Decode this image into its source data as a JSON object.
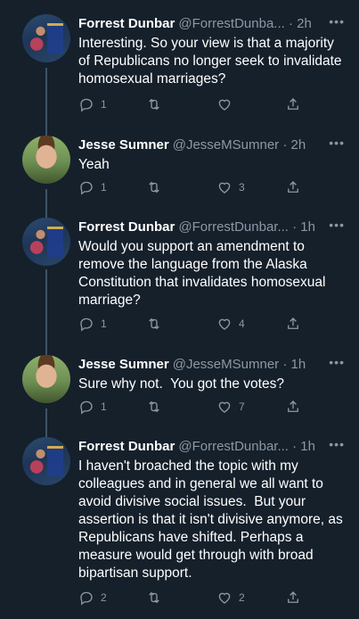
{
  "tweets": [
    {
      "name": "Forrest Dunbar",
      "handle": "@ForrestDunba... · 2h",
      "text": "Interesting. So your view is that a majority of Republicans no longer seek to invalidate homosexual marriages?",
      "reply_count": "1",
      "retweet_count": "",
      "like_count": "",
      "avatar": "forrest"
    },
    {
      "name": "Jesse Sumner",
      "handle": "@JesseMSumner · 2h",
      "text": "Yeah",
      "reply_count": "1",
      "retweet_count": "",
      "like_count": "3",
      "avatar": "jesse"
    },
    {
      "name": "Forrest Dunbar",
      "handle": "@ForrestDunbar... · 1h",
      "text": "Would you support an amendment to remove the language from the Alaska Constitution that invalidates homosexual marriage?",
      "reply_count": "1",
      "retweet_count": "",
      "like_count": "4",
      "avatar": "forrest"
    },
    {
      "name": "Jesse Sumner",
      "handle": "@JesseMSumner · 1h",
      "text": "Sure why not.  You got the votes?",
      "reply_count": "1",
      "retweet_count": "",
      "like_count": "7",
      "avatar": "jesse"
    },
    {
      "name": "Forrest Dunbar",
      "handle": "@ForrestDunbar... · 1h",
      "text": "I haven't broached the topic with my colleagues and in general we all want to avoid divisive social issues.  But your assertion is that it isn't divisive anymore, as Republicans have shifted. Perhaps a measure would get through with broad bipartisan support.",
      "reply_count": "2",
      "retweet_count": "",
      "like_count": "2",
      "avatar": "forrest"
    }
  ],
  "icons": {
    "reply": "reply-icon",
    "retweet": "retweet-icon",
    "like": "heart-icon",
    "share": "share-icon",
    "more": "more-icon"
  },
  "colors": {
    "background": "#15202b",
    "secondary_text": "#8b98a5",
    "thread_line": "#3d5466"
  }
}
